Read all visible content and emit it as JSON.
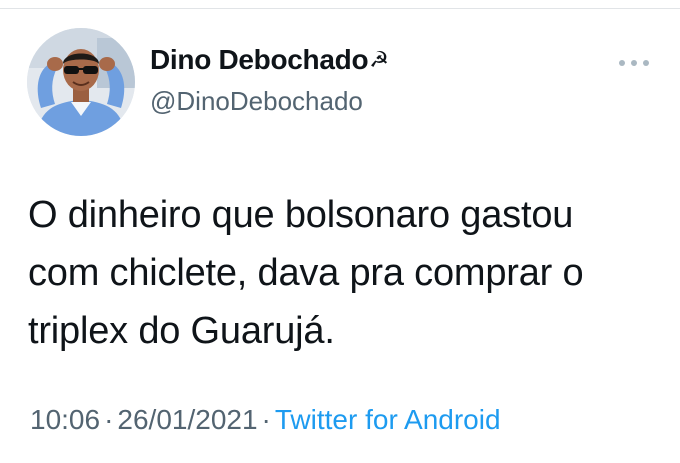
{
  "tweet": {
    "author": {
      "display_name": "Dino Debochado",
      "name_emblem": "☭",
      "handle": "@DinoDebochado"
    },
    "text_lines": [
      "O dinheiro que bolsonaro gastou",
      "com chiclete, dava pra comprar o",
      "triplex do Guarujá."
    ],
    "time": "10:06",
    "separator": "·",
    "date": "26/01/2021",
    "source": "Twitter for Android",
    "more_icon": "more-horizontal-icon"
  },
  "colors": {
    "text": "#0f1419",
    "muted": "#536471",
    "link": "#1d9bf0",
    "divider": "#e1e4e7"
  }
}
